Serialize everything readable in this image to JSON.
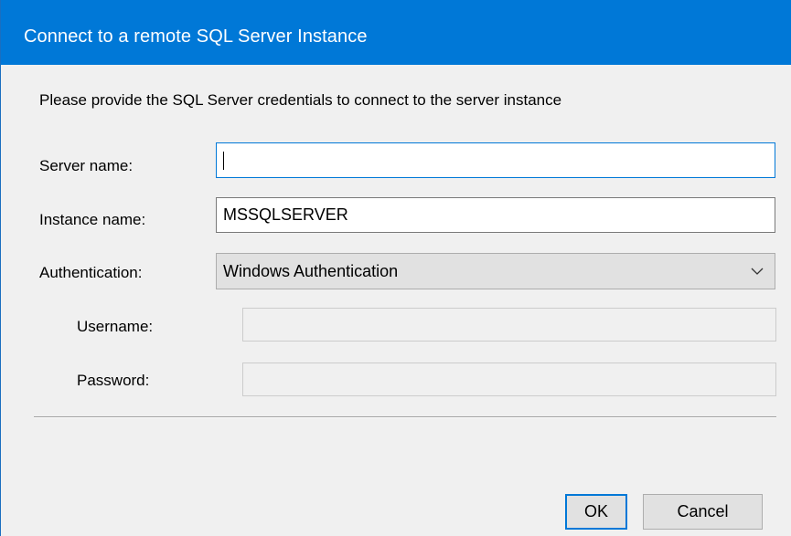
{
  "dialog": {
    "title": "Connect to a remote SQL Server Instance",
    "description": "Please provide the SQL Server credentials to connect to the server instance"
  },
  "form": {
    "server_name": {
      "label": "Server name:",
      "value": ""
    },
    "instance_name": {
      "label": "Instance name:",
      "value": "MSSQLSERVER"
    },
    "authentication": {
      "label": "Authentication:",
      "selected": "Windows Authentication"
    },
    "username": {
      "label": "Username:",
      "value": "",
      "enabled": false
    },
    "password": {
      "label": "Password:",
      "value": "",
      "enabled": false
    }
  },
  "buttons": {
    "ok_label": "OK",
    "cancel_label": "Cancel"
  },
  "colors": {
    "titlebar": "#0078d7",
    "focus_border": "#0078d7"
  },
  "icons": {
    "dropdown": "chevron-down-icon"
  }
}
